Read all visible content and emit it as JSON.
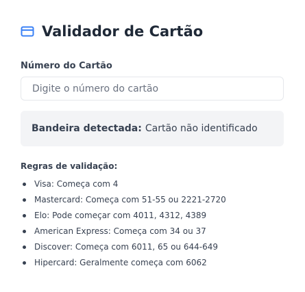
{
  "header": {
    "icon": "credit-card-icon",
    "title": "Validador de Cartão"
  },
  "card_number": {
    "label": "Número do Cartão",
    "value": "",
    "placeholder": "Digite o número do cartão"
  },
  "detected": {
    "label": "Bandeira detectada:",
    "value": "Cartão não identificado"
  },
  "rules": {
    "title": "Regras de validação:",
    "items": [
      {
        "text": "Visa: Começa com 4"
      },
      {
        "text": "Mastercard: Começa com 51-55 ou 2221-2720"
      },
      {
        "text": "Elo: Pode começar com 4011, 4312, 4389"
      },
      {
        "text": "American Express: Começa com 34 ou 37"
      },
      {
        "text": "Discover: Começa com 6011, 65 ou 644-649"
      },
      {
        "text": "Hipercard: Geralmente começa com 6062"
      }
    ]
  },
  "colors": {
    "accent": "#3b82f6",
    "text": "#1f2937",
    "panel_bg": "#f3f4f6"
  }
}
